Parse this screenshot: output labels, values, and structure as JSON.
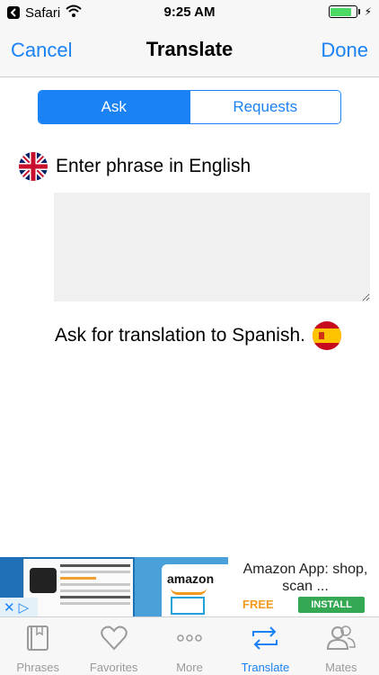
{
  "status_bar": {
    "back_app": "Safari",
    "time": "9:25 AM",
    "battery_level": 0.85,
    "charging_symbol": "⚡"
  },
  "nav": {
    "cancel_label": "Cancel",
    "title": "Translate",
    "done_label": "Done"
  },
  "segments": {
    "ask_label": "Ask",
    "requests_label": "Requests",
    "selected": "Ask"
  },
  "content": {
    "source_prompt": "Enter phrase in English",
    "source_flag": "uk-flag-icon",
    "phrase_value": "",
    "target_prompt": "Ask for translation to Spanish.",
    "target_flag": "spain-flag-icon"
  },
  "ad": {
    "headline": "Amazon App: shop, scan ...",
    "price": "FREE",
    "install_label": "INSTALL",
    "brand": "amazon",
    "close_symbol": "✕",
    "adchoices_symbol": "▷"
  },
  "tabs": [
    {
      "label": "Phrases",
      "icon": "book-icon",
      "active": false
    },
    {
      "label": "Favorites",
      "icon": "heart-icon",
      "active": false
    },
    {
      "label": "More",
      "icon": "more-dots-icon",
      "active": false
    },
    {
      "label": "Translate",
      "icon": "swap-arrows-icon",
      "active": true
    },
    {
      "label": "Mates",
      "icon": "people-icon",
      "active": false
    }
  ],
  "colors": {
    "accent": "#1a82f5",
    "battery": "#4cd964",
    "install": "#34a853",
    "free": "#f29a1e"
  }
}
